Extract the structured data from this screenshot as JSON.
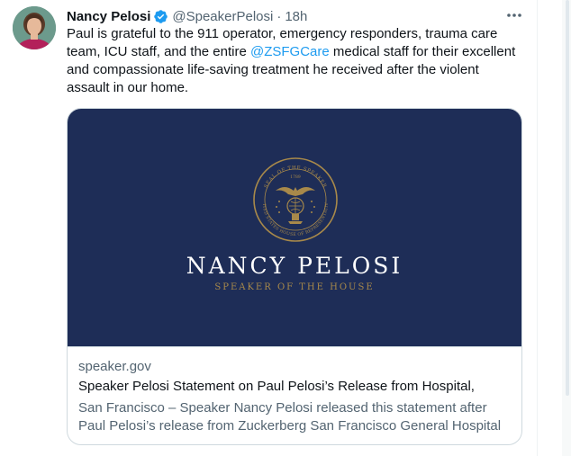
{
  "tweet": {
    "author_name": "Nancy Pelosi",
    "handle": "@SpeakerPelosi",
    "separator": "·",
    "time_ago": "18h",
    "text_before": "Paul is grateful to the 911 operator, emergency responders, trauma care team, ICU staff, and the entire ",
    "mention": "@ZSFGCare",
    "text_after": " medical staff for their excellent and compassionate life-saving treatment he received after the violent assault in our home."
  },
  "card": {
    "image": {
      "name": "NANCY PELOSI",
      "subtitle": "SPEAKER OF THE HOUSE",
      "seal_top": "SEAL OF THE SPEAKER",
      "seal_bottom": "UNITED STATES HOUSE OF REPRESENTATIVES",
      "seal_year": "1789",
      "background_color": "#1e2d57",
      "accent_color": "#a8894a"
    },
    "domain": "speaker.gov",
    "title": "Speaker Pelosi Statement on Paul Pelosi’s Release from Hospital,",
    "description": "San Francisco – Speaker Nancy Pelosi released this statement after Paul Pelosi’s release from Zuckerberg San Francisco General Hospital ..."
  },
  "icons": {
    "verified": "verified-badge-icon",
    "more": "more-horizontal-icon"
  },
  "colors": {
    "link": "#1d9bf0",
    "text": "#0f1419",
    "muted": "#536471",
    "border": "#cfd9de"
  }
}
